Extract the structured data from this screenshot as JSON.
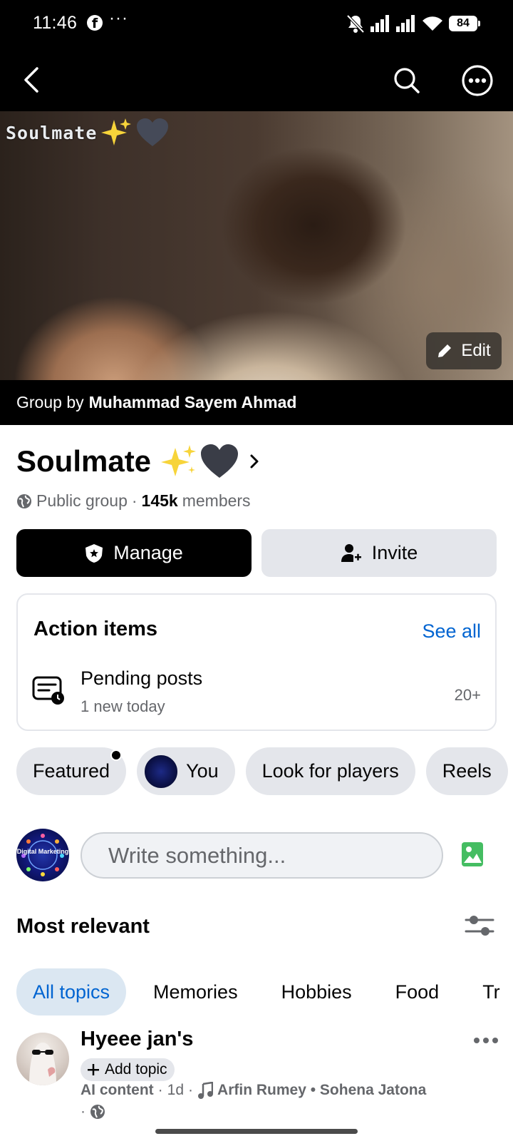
{
  "status_bar": {
    "time": "11:46",
    "app_icon": "f",
    "more": "···",
    "battery": "84",
    "icons": [
      "notifications-muted-icon",
      "signal-icon",
      "signal-icon",
      "wifi-icon",
      "battery-icon"
    ]
  },
  "nav": {
    "back_icon": "back-arrow-icon",
    "search_icon": "search-icon",
    "more_icon": "more-icon"
  },
  "cover": {
    "caption": "Soulmate",
    "edit_label": "Edit"
  },
  "owner": {
    "prefix": "Group by",
    "name": "Muhammad Sayem Ahmad"
  },
  "group": {
    "name": "Soulmate",
    "emoji": "✨🖤",
    "privacy": "Public group",
    "separator": "·",
    "member_count": "145k",
    "members_label": "members"
  },
  "buttons": {
    "manage": "Manage",
    "invite": "Invite"
  },
  "action_items": {
    "title": "Action items",
    "see_all": "See all",
    "pending_title": "Pending posts",
    "pending_sub": "1 new today",
    "pending_count": "20+"
  },
  "chips": [
    {
      "label": "Featured"
    },
    {
      "label": "You"
    },
    {
      "label": "Look for players"
    },
    {
      "label": "Reels"
    }
  ],
  "composer": {
    "placeholder": "Write something...",
    "avatar_text": "Digital Marketing"
  },
  "feed": {
    "sort_label": "Most relevant"
  },
  "topics": [
    {
      "label": "All topics",
      "active": true
    },
    {
      "label": "Memories"
    },
    {
      "label": "Hobbies"
    },
    {
      "label": "Food"
    },
    {
      "label": "Tr"
    }
  ],
  "post": {
    "author": "Hyeee jan's",
    "add_topic": "Add topic",
    "ai_label": "AI content",
    "sep": "·",
    "time": "1d",
    "audio": "Arfin Rumey • Sohena Jatona",
    "sep2": "·"
  },
  "colors": {
    "accent_blue": "#0064d1",
    "chip_gray": "#e4e6eb",
    "active_topic_bg": "#dbe7f2",
    "photo_green": "#45bd62"
  }
}
